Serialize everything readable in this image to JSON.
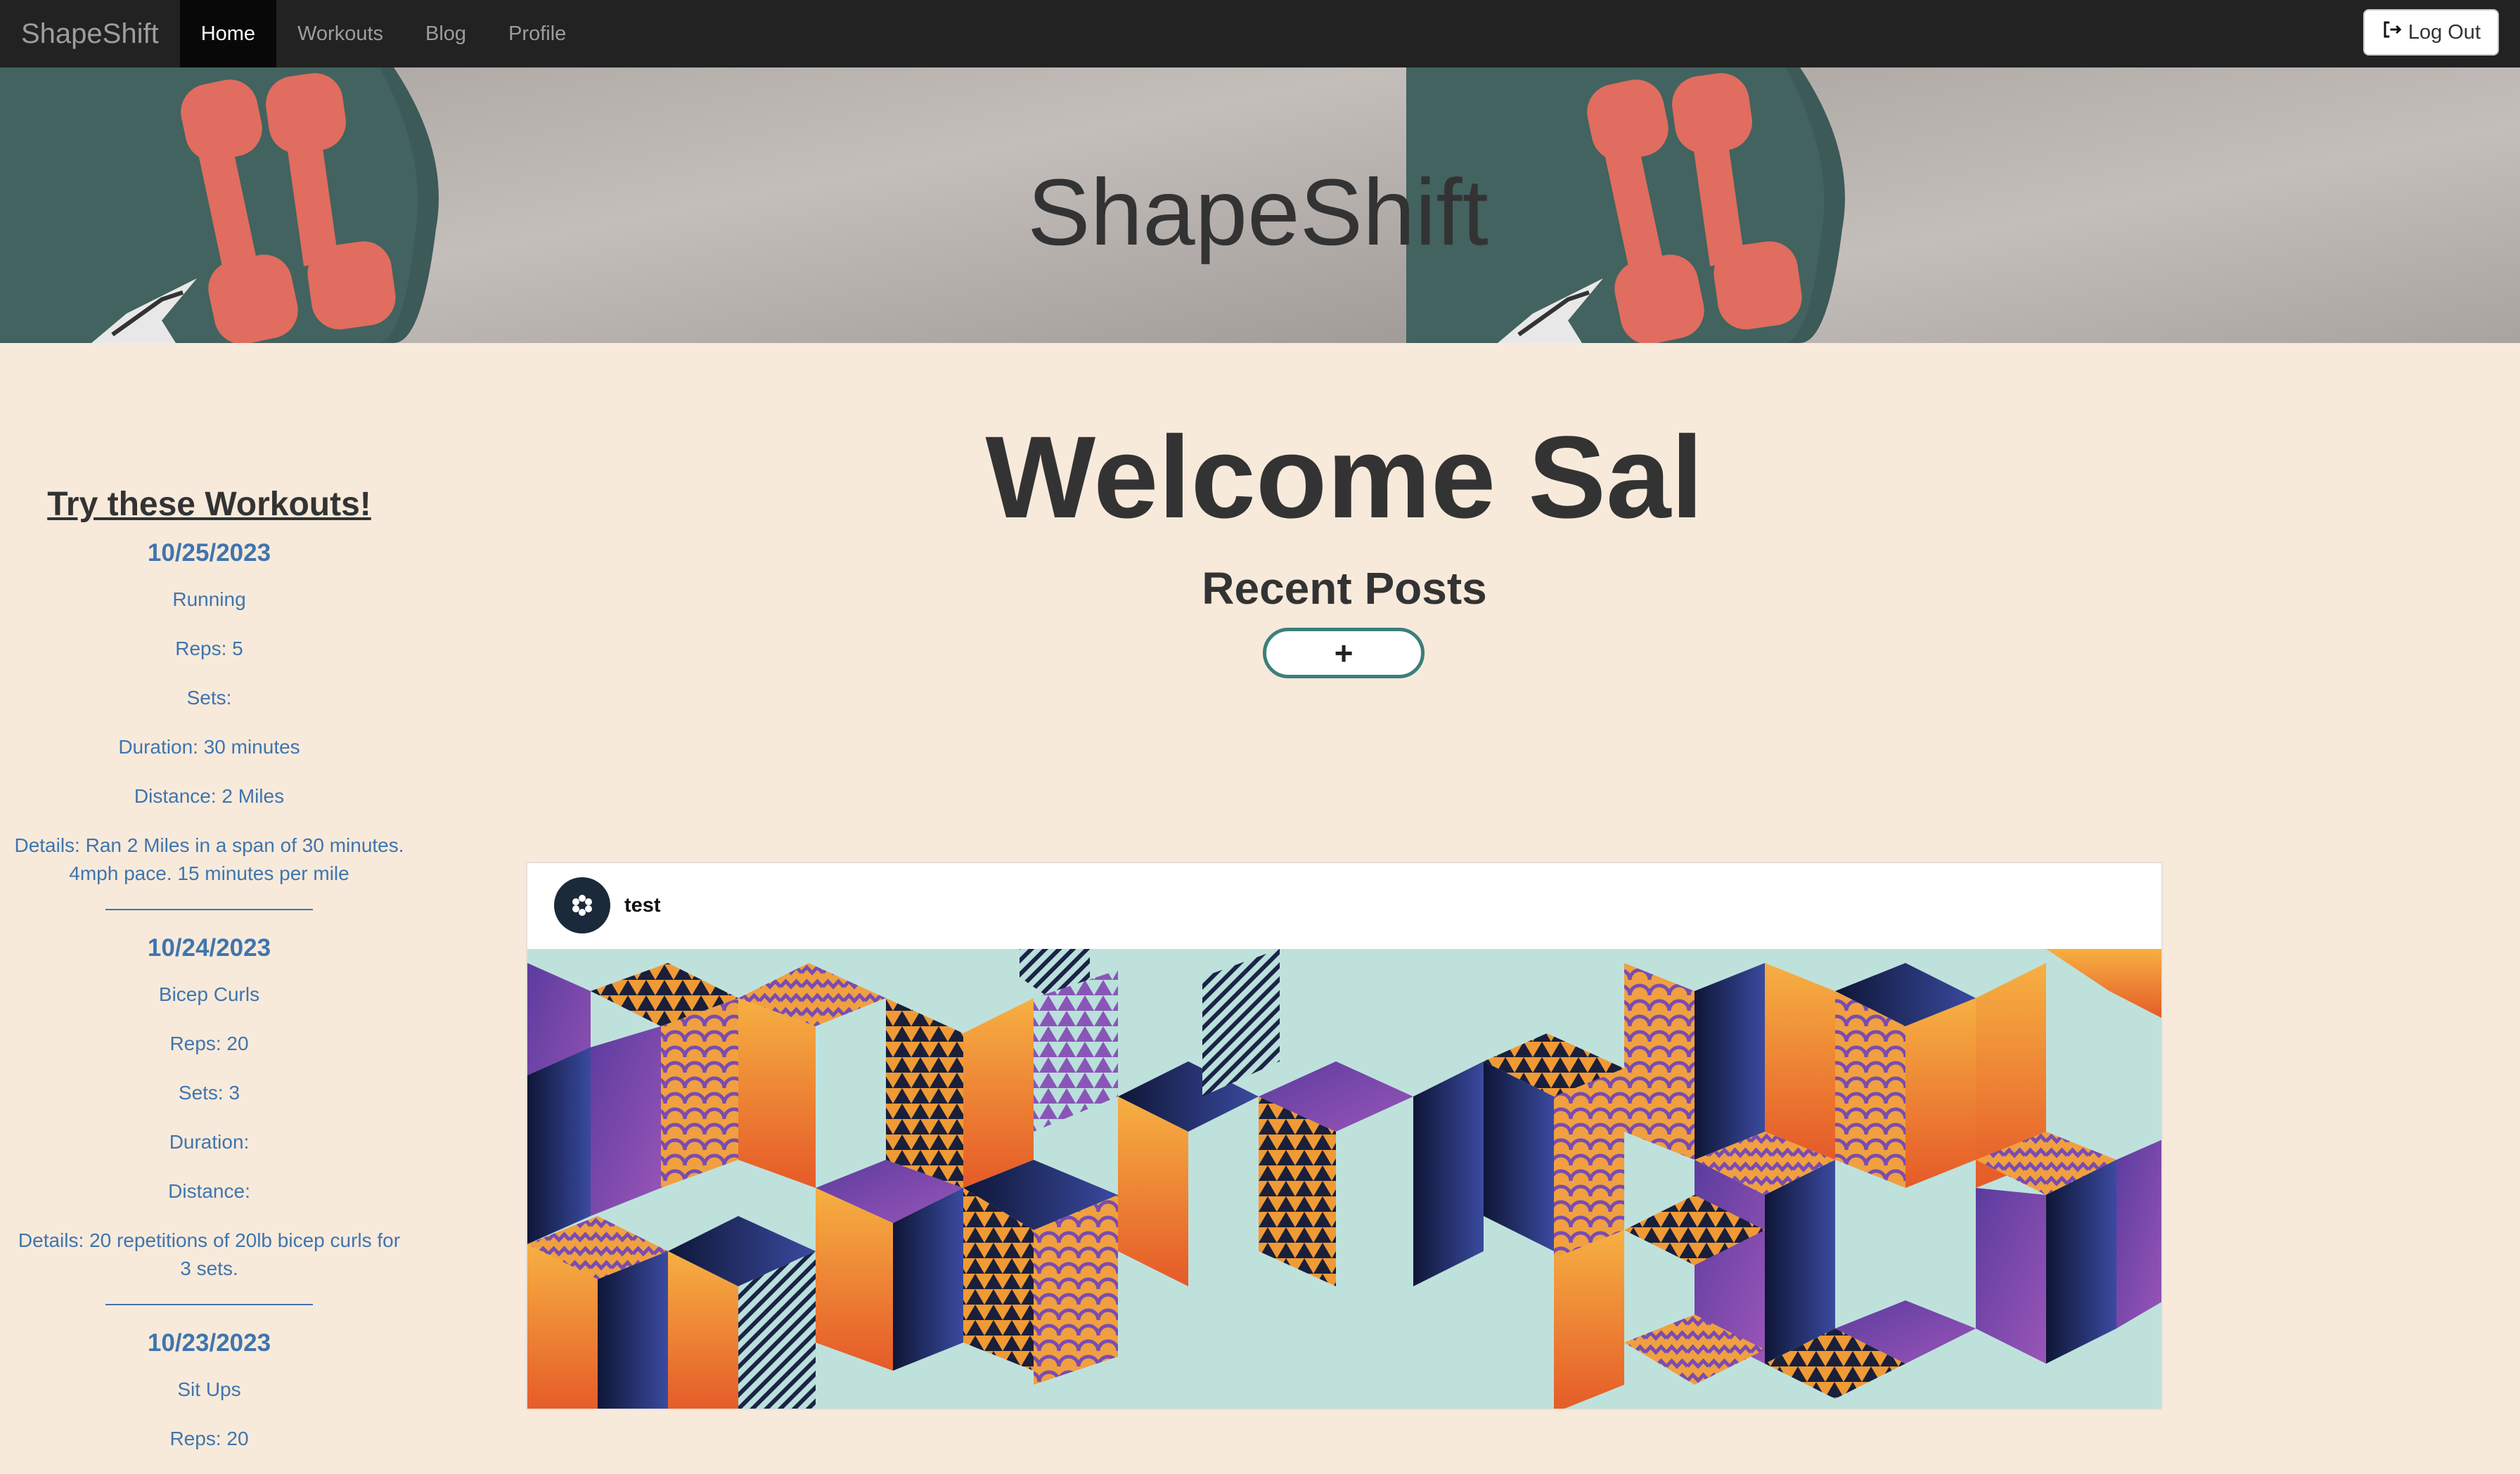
{
  "nav": {
    "brand": "ShapeShift",
    "items": [
      {
        "label": "Home",
        "active": true
      },
      {
        "label": "Workouts",
        "active": false
      },
      {
        "label": "Blog",
        "active": false
      },
      {
        "label": "Profile",
        "active": false
      }
    ],
    "logout_label": "Log Out",
    "logout_icon": "sign-out-icon"
  },
  "banner": {
    "title": "ShapeShift"
  },
  "sidebar": {
    "heading": "Try these Workouts!",
    "workouts": [
      {
        "date": "10/25/2023",
        "name": "Running",
        "reps": "Reps: 5",
        "sets": "Sets:",
        "duration": "Duration: 30 minutes",
        "distance": "Distance: 2 Miles",
        "details": "Details: Ran 2 Miles in a span of 30 minutes. 4mph pace. 15 minutes per mile"
      },
      {
        "date": "10/24/2023",
        "name": "Bicep Curls",
        "reps": "Reps: 20",
        "sets": "Sets: 3",
        "duration": "Duration:",
        "distance": "Distance:",
        "details": "Details: 20 repetitions of 20lb bicep curls for 3 sets."
      },
      {
        "date": "10/23/2023",
        "name": "Sit Ups",
        "reps": "Reps: 20"
      }
    ]
  },
  "main": {
    "welcome": "Welcome Sal",
    "recent_posts": "Recent Posts",
    "add_label": "+"
  },
  "post": {
    "author": "test",
    "avatar_icon": "shapeshift-logo-icon"
  },
  "colors": {
    "page_bg": "#f8eadb",
    "navbar_bg": "#222222",
    "link_blue": "#3f75ae",
    "button_border": "#3b7f7a"
  }
}
